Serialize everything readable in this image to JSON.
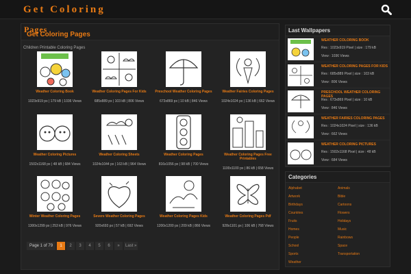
{
  "header": {
    "logo": "Get Coloring"
  },
  "main": {
    "title": "Pages",
    "subtitle": "Get Coloring Pages",
    "breadcrumb": "Children Printable Coloring Pages",
    "cards": [
      {
        "title": "Weather Coloring Book",
        "meta": "1023x919 px | 179 kB | 1036 Views"
      },
      {
        "title": "Weather Coloring Pages For Kids",
        "meta": "685x889 px | 103 kB | 806 Views"
      },
      {
        "title": "Preschool Weather Coloring Pages",
        "meta": "673x869 px | 10 kB | 846 Views"
      },
      {
        "title": "Weather Fairies Coloring Pages",
        "meta": "1024x1024 px | 136 kB | 662 Views"
      },
      {
        "title": "Weather Coloring Pictures",
        "meta": "1502x1168 px | 48 kB | 684 Views"
      },
      {
        "title": "Weather Coloring Sheets",
        "meta": "1024x1044 px | 163 kB | 964 Views"
      },
      {
        "title": "Weather Coloring Pages",
        "meta": "816x1056 px | 98 kB | 700 Views"
      },
      {
        "title": "Weather Coloring Pages Free Printables",
        "meta": "1100x1100 px | 86 kB | 658 Views"
      },
      {
        "title": "Winter Weather Coloring Pages",
        "meta": "1300x1299 px | 253 kB | 976 Views"
      },
      {
        "title": "Severe Weather Coloring Pages",
        "meta": "920x693 px | 57 kB | 692 Views"
      },
      {
        "title": "Weather Coloring Pages Kids",
        "meta": "1200x1200 px | 209 kB | 866 Views"
      },
      {
        "title": "Weather Coloring Pages Pdf",
        "meta": "928x1101 px | 106 kB | 768 Views"
      }
    ],
    "pager": {
      "info": "Page 1 of 79",
      "pages": [
        "1",
        "2",
        "3",
        "4",
        "5",
        "6",
        "»",
        "Last »"
      ]
    }
  },
  "sidebar": {
    "wallpapers_title": "Last Wallpapers",
    "wallpapers": [
      {
        "title": "WEATHER COLORING BOOK",
        "res": "Res : 1023x919 Pixel | size : 179 kB",
        "views": "View : 1036 Views"
      },
      {
        "title": "WEATHER COLORING PAGES FOR KIDS",
        "res": "Res : 685x889 Pixel | size : 103 kB",
        "views": "View : 806 Views"
      },
      {
        "title": "PRESCHOOL WEATHER COLORING PAGES",
        "res": "Res : 673x869 Pixel | size : 10 kB",
        "views": "View : 846 Views"
      },
      {
        "title": "WEATHER FAIRIES COLORING PAGES",
        "res": "Res : 1024x1024 Pixel | size : 136 kB",
        "views": "View : 662 Views"
      },
      {
        "title": "WEATHER COLORING PICTURES",
        "res": "Res : 1502x1168 Pixel | size : 48 kB",
        "views": "View : 684 Views"
      }
    ],
    "categories_title": "Categories",
    "categories": [
      "Alphabet",
      "Animals",
      "Artwork",
      "Bible",
      "Birthdays",
      "Cartoons",
      "Countries",
      "Flowers",
      "Fruits",
      "Holidays",
      "Homes",
      "Music",
      "People",
      "Rainbows",
      "School",
      "Space",
      "Sports",
      "Transportation",
      "Weather"
    ]
  },
  "colors": {
    "accent": "#e87a14",
    "background": "#1b1b1b",
    "panel": "#232323"
  },
  "icons": {
    "search": "search-icon"
  }
}
